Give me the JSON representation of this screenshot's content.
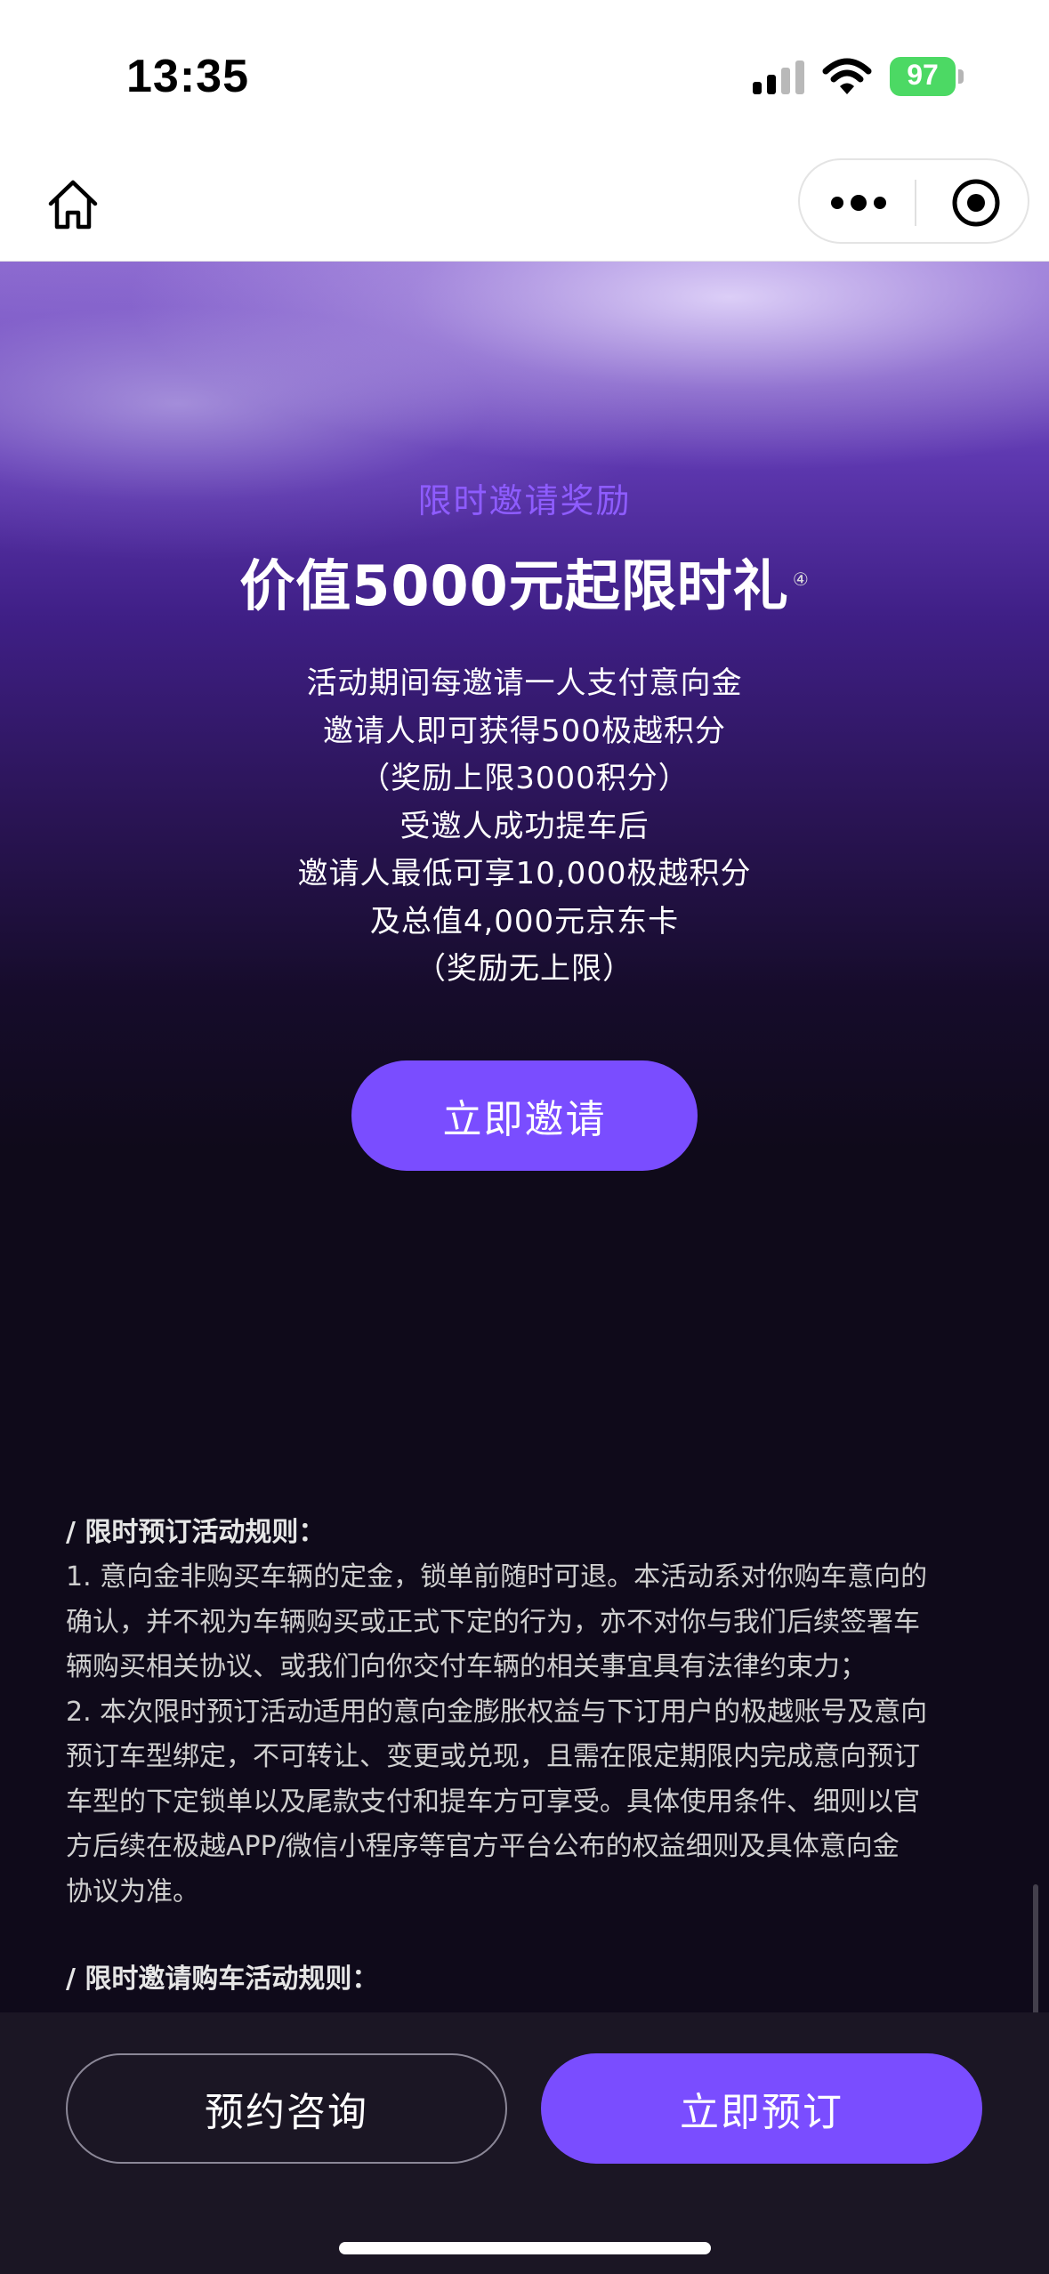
{
  "status_bar": {
    "time": "13:35",
    "battery": "97",
    "icons": [
      "signal-icon",
      "wifi-icon",
      "battery-icon"
    ]
  },
  "nav": {
    "icons": [
      "home-icon",
      "more-icon",
      "close-miniprogram-icon"
    ]
  },
  "hero": {
    "subtitle": "限时邀请奖励",
    "title": "价值5000元起限时礼",
    "title_sup": "④",
    "lines": [
      "活动期间每邀请一人支付意向金",
      "邀请人即可获得500极越积分",
      "（奖励上限3000积分）",
      "受邀人成功提车后",
      "邀请人最低可享10,000极越积分",
      "及总值4,000元京东卡",
      "（奖励无上限）"
    ],
    "invite_button": "立即邀请"
  },
  "rules": {
    "heading1": "/ 限时预订活动规则：",
    "lines1": [
      "1. 意向金非购买车辆的定金，锁单前随时可退。本活动系对你购车意向的",
      "确认，并不视为车辆购买或正式下定的行为，亦不对你与我们后续签署车",
      "辆购买相关协议、或我们向你交付车辆的相关事宜具有法律约束力；",
      "2. 本次限时预订活动适用的意向金膨胀权益与下订用户的极越账号及意向",
      "预订车型绑定，不可转让、变更或兑现，且需在限定期限内完成意向预订",
      "车型的下定锁单以及尾款支付和提车方可享受。具体使用条件、细则以官",
      "方后续在极越APP/微信小程序等官方平台公布的权益细则及具体意向金",
      "协议为准。"
    ],
    "heading2": "/ 限时邀请购车活动规则："
  },
  "bottom": {
    "consult_button": "预约咨询",
    "order_button": "立即预订"
  },
  "colors": {
    "accent": "#7a4dff",
    "subtitle": "#8e5cff",
    "battery": "#4cd964",
    "background": "#0f0a1a"
  }
}
